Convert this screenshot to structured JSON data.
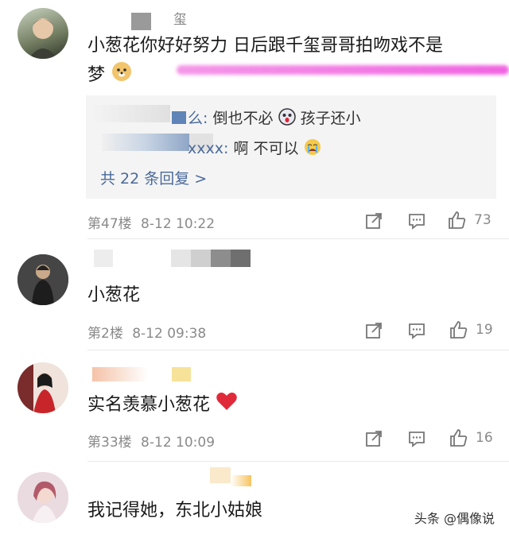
{
  "comments": [
    {
      "username_visible": "玺",
      "text_line1": "小葱花你好好努力  日后跟千玺哥哥拍吻戏不是",
      "text_line2": "梦",
      "replies": [
        {
          "user_suffix": "么:",
          "text": "倒也不必",
          "text2": "孩子还小"
        },
        {
          "user_suffix": "xxxx:",
          "text": "啊 不可以"
        }
      ],
      "more_replies": "共 22 条回复 >",
      "floor": "第47楼",
      "time": "8-12 10:22",
      "likes": "73"
    },
    {
      "text": "小葱花",
      "floor": "第2楼",
      "time": "8-12 09:38",
      "likes": "19"
    },
    {
      "text": "实名羡慕小葱花",
      "floor": "第33楼",
      "time": "8-12 10:09",
      "likes": "16"
    },
    {
      "text": "我记得她，东北小姑娘"
    }
  ],
  "watermark": "头条 @偶像说",
  "icons": [
    "share-icon",
    "comment-icon",
    "like-icon",
    "heart-emoji",
    "doge-emoji",
    "scared-emoji",
    "crying-emoji"
  ],
  "colors": {
    "link": "#4a6a9a",
    "meta": "#8a8a8a",
    "reply_bg": "#f4f4f4",
    "highlight": "#f06ee1"
  }
}
